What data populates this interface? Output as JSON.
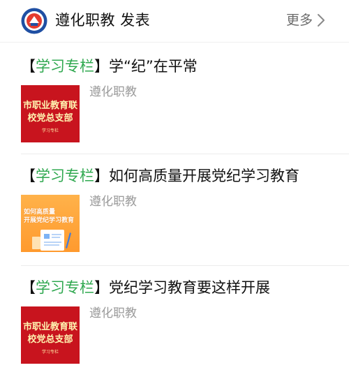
{
  "header": {
    "account_name": "遵化职教 发表",
    "more_label": "更多",
    "logo_icon": "school-emblem-icon",
    "chevron_icon": "chevron-right-icon"
  },
  "articles": [
    {
      "bracket_open": "【",
      "tag": "学习专栏",
      "bracket_close": "】",
      "title": "学“纪”在平常",
      "source": "遵化职教",
      "thumb": {
        "style": "red",
        "line1": "市职业教育联",
        "line2": "校党总支部",
        "caption": "学习专栏"
      }
    },
    {
      "bracket_open": "【",
      "tag": "学习专栏",
      "bracket_close": "】",
      "title": "如何高质量开展党纪学习教育",
      "source": "遵化职教",
      "thumb": {
        "style": "orange",
        "line1": "如何高质量",
        "line2": "开展党纪学习教育"
      }
    },
    {
      "bracket_open": "【",
      "tag": "学习专栏",
      "bracket_close": "】",
      "title": "党纪学习教育要这样开展",
      "source": "遵化职教",
      "thumb": {
        "style": "red",
        "line1": "市职业教育联",
        "line2": "校党总支部",
        "caption": "学习专栏"
      }
    }
  ],
  "colors": {
    "tag_green": "#2fa84f",
    "thumb_red": "#c8141e",
    "thumb_orange": "#ff9a2e",
    "source_gray": "#9a9a9a"
  }
}
